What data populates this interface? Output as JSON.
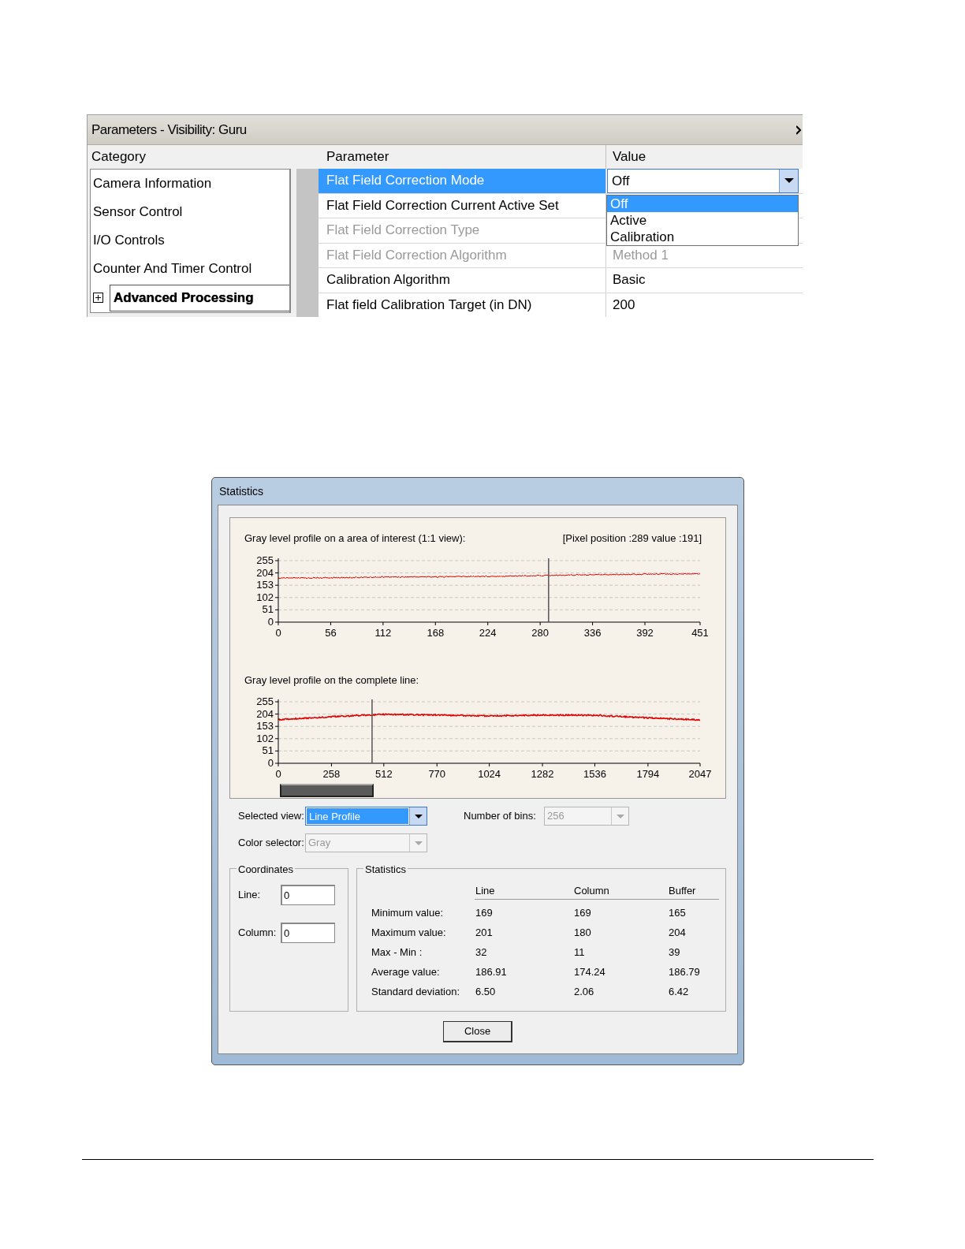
{
  "parameters_panel": {
    "title": "Parameters - Visibility: Guru",
    "category_header": "Category",
    "parameter_header": "Parameter",
    "value_header": "Value",
    "categories": [
      {
        "label": "Camera Information",
        "selected": false,
        "expandable": false
      },
      {
        "label": "Sensor Control",
        "selected": false,
        "expandable": false
      },
      {
        "label": "I/O Controls",
        "selected": false,
        "expandable": false
      },
      {
        "label": "Counter And Timer Control",
        "selected": false,
        "expandable": false
      },
      {
        "label": "Advanced Processing",
        "selected": true,
        "expandable": true
      }
    ],
    "rows": [
      {
        "name": "Flat Field Correction Mode",
        "selected": true,
        "disabled": false,
        "value": "Off",
        "kind": "dropdown"
      },
      {
        "name": "Flat Field Correction Current Active Set",
        "selected": false,
        "disabled": false,
        "kind": "hidden"
      },
      {
        "name": "Flat Field Correction Type",
        "selected": false,
        "disabled": true,
        "kind": "hidden"
      },
      {
        "name": "Flat Field Correction Algorithm",
        "selected": false,
        "disabled": true,
        "value": "Method 1",
        "kind": "text"
      },
      {
        "name": "Calibration Algorithm",
        "selected": false,
        "disabled": false,
        "value": "Basic",
        "kind": "text"
      },
      {
        "name": "Flat field Calibration Target (in DN)",
        "selected": false,
        "disabled": false,
        "value": "200",
        "kind": "text"
      }
    ],
    "dropdown_options": [
      {
        "label": "Off",
        "selected": true
      },
      {
        "label": "Active",
        "selected": false
      },
      {
        "label": "Calibration",
        "selected": false
      }
    ]
  },
  "statistics_dialog": {
    "title": "Statistics",
    "profiles": [
      {
        "title": "Gray level profile on a area of interest (1:1 view):",
        "readout": "[Pixel position :289  value :191]",
        "chart_data": {
          "type": "line",
          "x": [
            0,
            56,
            112,
            168,
            224,
            280,
            336,
            392,
            451
          ],
          "series": [
            {
              "color": "#e00000",
              "values": [
                182,
                184,
                187,
                188,
                190,
                193,
                197,
                199,
                200
              ]
            }
          ],
          "xlim": [
            0,
            451
          ],
          "ylim": [
            0,
            255
          ],
          "xticks": [
            0,
            56,
            112,
            168,
            224,
            280,
            336,
            392,
            451
          ],
          "yticks": [
            0,
            51,
            102,
            153,
            204,
            255
          ],
          "grid": true,
          "ref_lines": [
            {
              "axis": "x",
              "value": 289,
              "color": "#555555"
            }
          ]
        }
      },
      {
        "title": "Gray level profile on the complete line:",
        "chart_data": {
          "type": "line",
          "x": [
            0,
            258,
            512,
            770,
            1024,
            1282,
            1536,
            1794,
            2047
          ],
          "series": [
            {
              "color": "#e00000",
              "values": [
                181,
                193,
                203,
                200,
                196,
                200,
                199,
                188,
                180
              ]
            }
          ],
          "xlim": [
            0,
            2047
          ],
          "ylim": [
            0,
            255
          ],
          "xticks": [
            0,
            258,
            512,
            770,
            1024,
            1282,
            1536,
            1794,
            2047
          ],
          "yticks": [
            0,
            51,
            102,
            153,
            204,
            255
          ],
          "grid": true,
          "ref_lines": [
            {
              "axis": "x",
              "value": 455,
              "color": "#555555"
            }
          ]
        }
      }
    ],
    "selected_view": {
      "label": "Selected view:",
      "value": "Line Profile",
      "disabled": false
    },
    "number_of_bins": {
      "label": "Number of bins:",
      "value": "256",
      "disabled": true
    },
    "color_selector": {
      "label": "Color selector:",
      "value": "Gray",
      "disabled": true
    },
    "coordinates": {
      "title": "Coordinates",
      "fields": [
        {
          "label": "Line:",
          "value": "0"
        },
        {
          "label": "Column:",
          "value": "0"
        }
      ]
    },
    "statistics": {
      "title": "Statistics",
      "columns": [
        "Line",
        "Column",
        "Buffer"
      ],
      "rows": [
        {
          "label": "Minimum value:",
          "values": [
            "169",
            "169",
            "165"
          ]
        },
        {
          "label": "Maximum value:",
          "values": [
            "201",
            "180",
            "204"
          ]
        },
        {
          "label": "Max - Min :",
          "values": [
            "32",
            "11",
            "39"
          ]
        },
        {
          "label": "Average value:",
          "values": [
            "186.91",
            "174.24",
            "186.79"
          ]
        },
        {
          "label": "Standard deviation:",
          "values": [
            "6.50",
            "2.06",
            "6.42"
          ]
        }
      ]
    },
    "close_button": "Close"
  }
}
